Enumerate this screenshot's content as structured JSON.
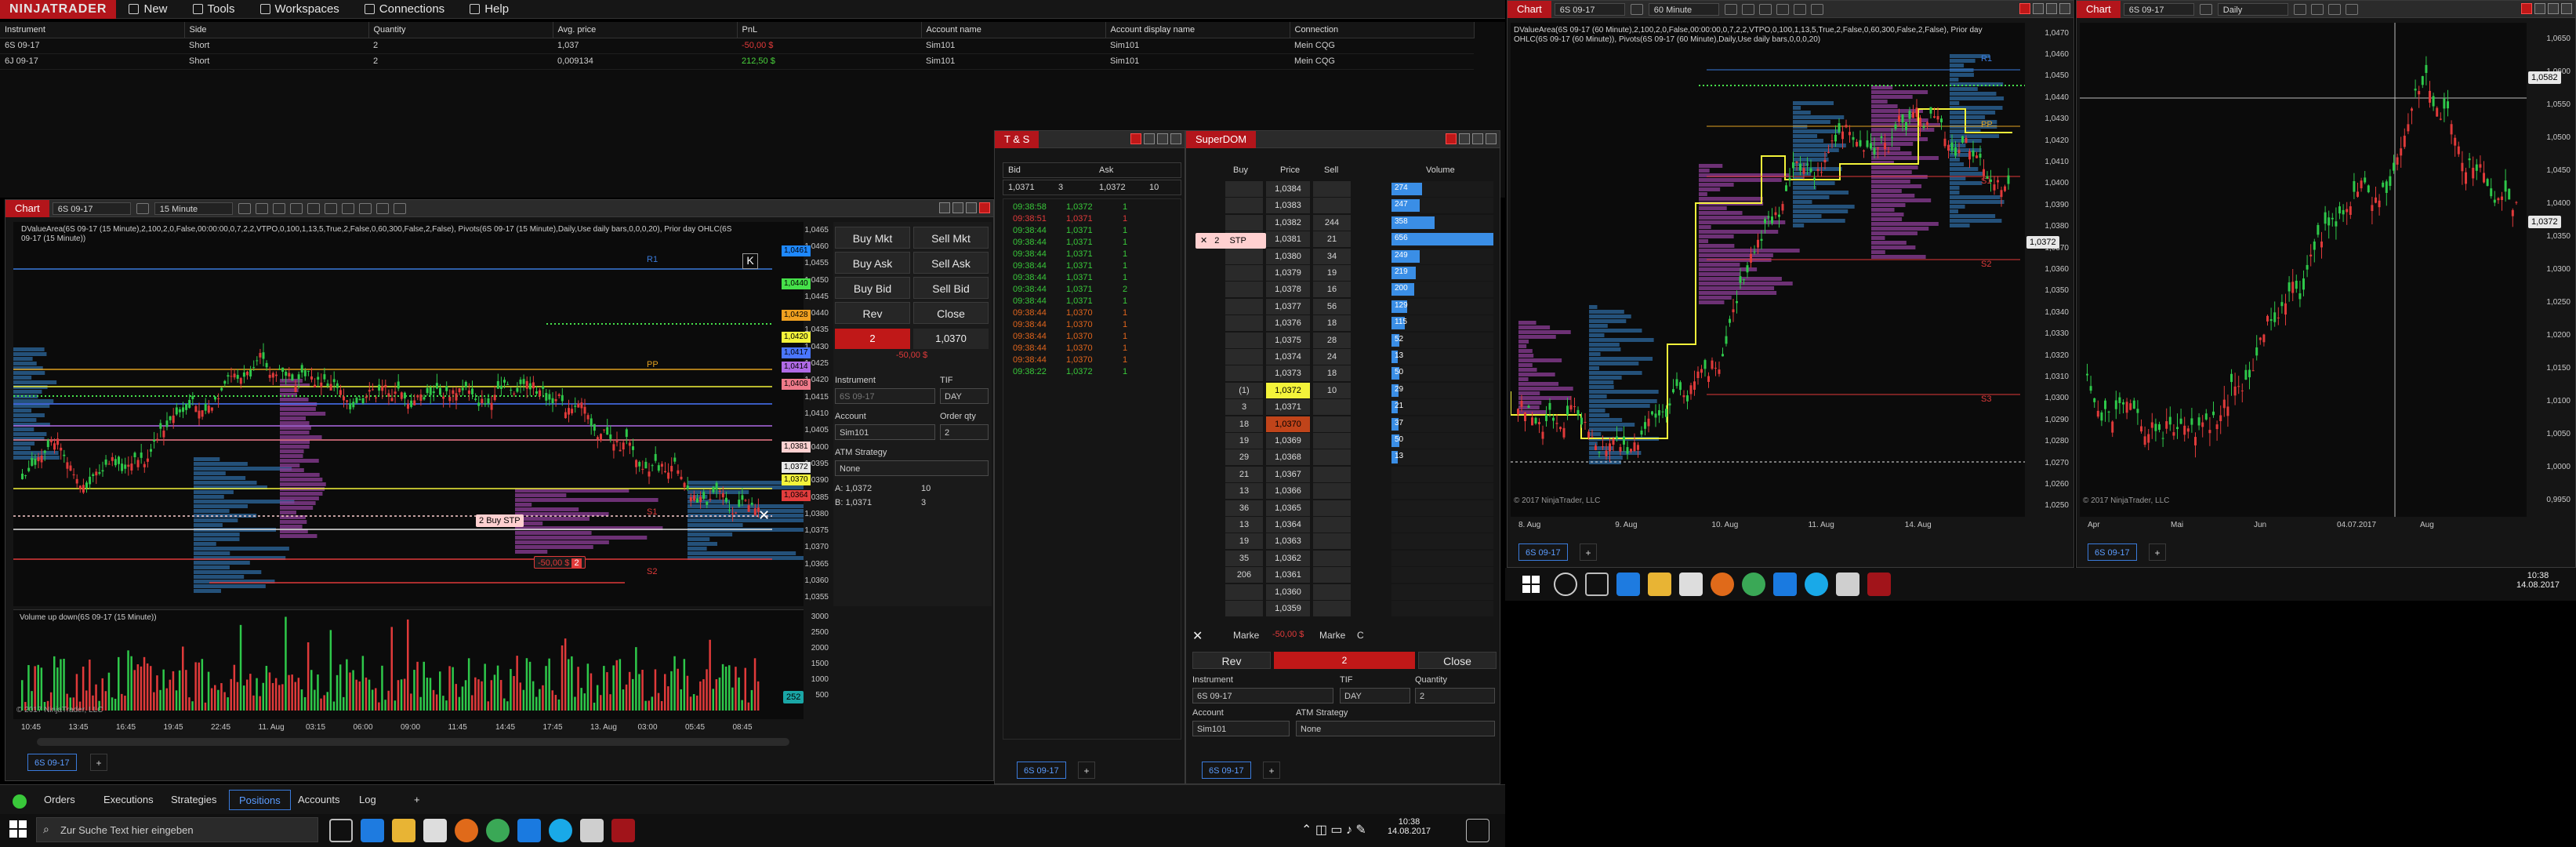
{
  "app": {
    "brand": "NINJATRADER",
    "menu": [
      {
        "label": "New",
        "icon": "new-icon"
      },
      {
        "label": "Tools",
        "icon": "tools-icon"
      },
      {
        "label": "Workspaces",
        "icon": "workspaces-icon"
      },
      {
        "label": "Connections",
        "icon": "connections-icon"
      },
      {
        "label": "Help",
        "icon": "help-icon"
      }
    ]
  },
  "positions": {
    "columns": [
      "Instrument",
      "Side",
      "Quantity",
      "Avg. price",
      "PnL",
      "Account name",
      "Account display name",
      "Connection"
    ],
    "rows": [
      [
        "6S 09-17",
        "Short",
        "2",
        "1,037",
        "-50,00 $",
        "Sim101",
        "Sim101",
        "Mein CQG"
      ],
      [
        "6J 09-17",
        "Short",
        "2",
        "0,009134",
        "212,50 $",
        "Sim101",
        "Sim101",
        "Mein CQG"
      ]
    ],
    "tabs": [
      "Orders",
      "Executions",
      "Strategies",
      "Positions",
      "Accounts",
      "Log"
    ],
    "active_tab": "Positions"
  },
  "chart1": {
    "title": "Chart",
    "instrument": "6S 09-17",
    "interval": "15 Minute",
    "indicator_text": "DValueArea(6S 09-17 (15 Minute),2,100,2,0,False,00:00:00,0,7,2,2,VTPO,0,100,1,13,5,True,2,False,0,60,300,False,2,False), Pivots(6S 09-17 (15 Minute),Daily,Use daily bars,0,0,0,20), Prior day OHLC(6S 09-17 (15 Minute))",
    "volume_label": "Volume up down(6S 09-17 (15 Minute))",
    "copyright": "© 2017 NinjaTrader, LLC",
    "y_ticks": [
      "1,0465",
      "1,0460",
      "1,0455",
      "1,0450",
      "1,0445",
      "1,0440",
      "1,0435",
      "1,0430",
      "1,0425",
      "1,0420",
      "1,0415",
      "1,0410",
      "1,0405",
      "1,0400",
      "1,0395",
      "1,0390",
      "1,0385",
      "1,0380",
      "1,0375",
      "1,0370",
      "1,0365",
      "1,0360",
      "1,0355"
    ],
    "price_labels": [
      {
        "text": "1,0461",
        "color": "#1e88ff"
      },
      {
        "text": "1,0440",
        "color": "#46e04a"
      },
      {
        "text": "1,0428",
        "color": "#f0a020"
      },
      {
        "text": "1,0420",
        "color": "#f3f33a"
      },
      {
        "text": "1,0417",
        "color": "#4a76ff"
      },
      {
        "text": "1,0414",
        "color": "#b06ae6"
      },
      {
        "text": "1,0408",
        "color": "#ef7a8a"
      },
      {
        "text": "1,0381",
        "color": "#ffd0d0"
      },
      {
        "text": "1,0372",
        "color": "#e8e8e8"
      },
      {
        "text": "1,0370",
        "color": "#f3f33a"
      },
      {
        "text": "1,0364",
        "color": "#e23d3d"
      }
    ],
    "level_tags": [
      "R1",
      "PP",
      "S1",
      "S2"
    ],
    "order_tag": {
      "qty": "2",
      "type": "Buy STP"
    },
    "pnl_tag": {
      "pnl": "-50,00 $",
      "qty": "2"
    },
    "x_ticks": [
      "10:45",
      "13:45",
      "16:45",
      "19:45",
      "22:45",
      "11. Aug",
      "03:15",
      "06:00",
      "09:00",
      "11:45",
      "14:45",
      "17:45",
      "13. Aug",
      "03:00",
      "05:45",
      "08:45"
    ],
    "vol_ticks": [
      "3000",
      "2500",
      "2000",
      "1500",
      "1000",
      "500"
    ],
    "vol_last": "252",
    "tab": "6S 09-17"
  },
  "order_panel": {
    "buy_mkt": "Buy Mkt",
    "sell_mkt": "Sell Mkt",
    "buy_ask": "Buy Ask",
    "sell_ask": "Sell Ask",
    "buy_bid": "Buy Bid",
    "sell_bid": "Sell Bid",
    "rev": "Rev",
    "close": "Close",
    "position_qty": "2",
    "position_price": "1,0370",
    "position_pnl": "-50,00 $",
    "instrument_label": "Instrument",
    "instrument_value": "6S 09-17",
    "tif_label": "TIF",
    "tif_value": "DAY",
    "account_label": "Account",
    "account_value": "Sim101",
    "qty_label": "Order qty",
    "qty_value": "2",
    "atm_label": "ATM Strategy",
    "atm_value": "None",
    "ask_line": "A: 1,0372",
    "ask_size": "10",
    "bid_line": "B: 1,0371",
    "bid_size": "3"
  },
  "ts": {
    "title": "T & S",
    "bid_label": "Bid",
    "ask_label": "Ask",
    "bid": "1,0371",
    "bid_size": "3",
    "ask": "1,0372",
    "ask_size": "10",
    "rows": [
      {
        "time": "09:38:58",
        "price": "1,0372",
        "size": "1",
        "color": "#39c83a"
      },
      {
        "time": "09:38:51",
        "price": "1,0371",
        "size": "1",
        "color": "#e03a3a"
      },
      {
        "time": "09:38:44",
        "price": "1,0371",
        "size": "1",
        "color": "#39c83a"
      },
      {
        "time": "09:38:44",
        "price": "1,0371",
        "size": "1",
        "color": "#39c83a"
      },
      {
        "time": "09:38:44",
        "price": "1,0371",
        "size": "1",
        "color": "#39c83a"
      },
      {
        "time": "09:38:44",
        "price": "1,0371",
        "size": "1",
        "color": "#39c83a"
      },
      {
        "time": "09:38:44",
        "price": "1,0371",
        "size": "1",
        "color": "#39c83a"
      },
      {
        "time": "09:38:44",
        "price": "1,0371",
        "size": "2",
        "color": "#39c83a"
      },
      {
        "time": "09:38:44",
        "price": "1,0371",
        "size": "1",
        "color": "#39c83a"
      },
      {
        "time": "09:38:44",
        "price": "1,0370",
        "size": "1",
        "color": "#e0651d"
      },
      {
        "time": "09:38:44",
        "price": "1,0370",
        "size": "1",
        "color": "#e0651d"
      },
      {
        "time": "09:38:44",
        "price": "1,0370",
        "size": "1",
        "color": "#e0651d"
      },
      {
        "time": "09:38:44",
        "price": "1,0370",
        "size": "1",
        "color": "#e0651d"
      },
      {
        "time": "09:38:44",
        "price": "1,0370",
        "size": "1",
        "color": "#e0651d"
      },
      {
        "time": "09:38:22",
        "price": "1,0372",
        "size": "1",
        "color": "#39c83a"
      }
    ],
    "tab": "6S 09-17"
  },
  "superdom": {
    "title": "SuperDOM",
    "col_buy": "Buy",
    "col_price": "Price",
    "col_sell": "Sell",
    "col_volume": "Volume",
    "rows": [
      {
        "buy": "",
        "price": "1,0384",
        "sell": "",
        "vol": "274",
        "volpct": 0.3
      },
      {
        "buy": "",
        "price": "1,0383",
        "sell": "",
        "vol": "247",
        "volpct": 0.28
      },
      {
        "buy": "",
        "price": "1,0382",
        "sell": "244",
        "vol": "358",
        "volpct": 0.42
      },
      {
        "buy": "",
        "price": "1,0381",
        "sell": "21",
        "vol": "656",
        "volpct": 1.0
      },
      {
        "buy": "",
        "price": "1,0380",
        "sell": "34",
        "vol": "249",
        "volpct": 0.28
      },
      {
        "buy": "",
        "price": "1,0379",
        "sell": "19",
        "vol": "219",
        "volpct": 0.24
      },
      {
        "buy": "",
        "price": "1,0378",
        "sell": "16",
        "vol": "200",
        "volpct": 0.22
      },
      {
        "buy": "",
        "price": "1,0377",
        "sell": "56",
        "vol": "129",
        "volpct": 0.15
      },
      {
        "buy": "",
        "price": "1,0376",
        "sell": "18",
        "vol": "115",
        "volpct": 0.13
      },
      {
        "buy": "",
        "price": "1,0375",
        "sell": "28",
        "vol": "52",
        "volpct": 0.08
      },
      {
        "buy": "",
        "price": "1,0374",
        "sell": "24",
        "vol": "13",
        "volpct": 0.06
      },
      {
        "buy": "",
        "price": "1,0373",
        "sell": "18",
        "vol": "50",
        "volpct": 0.08
      },
      {
        "buy": "(1)",
        "price": "1,0372",
        "sell": "10",
        "vol": "29",
        "volpct": 0.07
      },
      {
        "buy": "3",
        "price": "1,0371",
        "sell": "",
        "vol": "21",
        "volpct": 0.06
      },
      {
        "buy": "18",
        "price": "1,0370",
        "sell": "",
        "vol": "37",
        "volpct": 0.07
      },
      {
        "buy": "19",
        "price": "1,0369",
        "sell": "",
        "vol": "50",
        "volpct": 0.08
      },
      {
        "buy": "29",
        "price": "1,0368",
        "sell": "",
        "vol": "13",
        "volpct": 0.06
      },
      {
        "buy": "21",
        "price": "1,0367",
        "sell": "",
        "vol": "",
        "volpct": 0
      },
      {
        "buy": "13",
        "price": "1,0366",
        "sell": "",
        "vol": "",
        "volpct": 0
      },
      {
        "buy": "36",
        "price": "1,0365",
        "sell": "",
        "vol": "",
        "volpct": 0
      },
      {
        "buy": "13",
        "price": "1,0364",
        "sell": "",
        "vol": "",
        "volpct": 0
      },
      {
        "buy": "19",
        "price": "1,0363",
        "sell": "",
        "vol": "",
        "volpct": 0
      },
      {
        "buy": "35",
        "price": "1,0362",
        "sell": "",
        "vol": "",
        "volpct": 0
      },
      {
        "buy": "206",
        "price": "1,0361",
        "sell": "",
        "vol": "",
        "volpct": 0
      },
      {
        "buy": "",
        "price": "1,0360",
        "sell": "",
        "vol": "",
        "volpct": 0
      },
      {
        "buy": "",
        "price": "1,0359",
        "sell": "",
        "vol": "",
        "volpct": 0
      }
    ],
    "stop_order": {
      "qty": "2",
      "type": "STP"
    },
    "market_buy": "Marke",
    "pnl": "-50,00 $",
    "market_sell": "Marke",
    "c": "C",
    "rev": "Rev",
    "qty_box": "2",
    "close": "Close",
    "instrument_label": "Instrument",
    "instrument_value": "6S 09-17",
    "tif_label": "TIF",
    "tif_value": "DAY",
    "quantity_label": "Quantity",
    "quantity_value": "2",
    "account_label": "Account",
    "account_value": "Sim101",
    "atm_label": "ATM Strategy",
    "atm_value": "None",
    "tab": "6S 09-17"
  },
  "chart2": {
    "title": "Chart",
    "instrument": "6S 09-17",
    "interval": "60 Minute",
    "indicator_text": "DValueArea(6S 09-17 (60 Minute),2,100,2,0,False,00:00:00,0,7,2,2,VTPO,0,100,1,13,5,True,2,False,0,60,300,False,2,False), Prior day OHLC(6S 09-17 (60 Minute)), Pivots(6S 09-17 (60 Minute),Daily,Use daily bars,0,0,0,20)",
    "y_ticks": [
      "1,0470",
      "1,0460",
      "1,0450",
      "1,0440",
      "1,0430",
      "1,0420",
      "1,0410",
      "1,0400",
      "1,0390",
      "1,0380",
      "1,0370",
      "1,0360",
      "1,0350",
      "1,0340",
      "1,0330",
      "1,0320",
      "1,0310",
      "1,0300",
      "1,0290",
      "1,0280",
      "1,0270",
      "1,0260",
      "1,0250"
    ],
    "last": "1,0372",
    "x_ticks": [
      "8. Aug",
      "9. Aug",
      "10. Aug",
      "11. Aug",
      "14. Aug"
    ],
    "level_tags": [
      "R1",
      "PP",
      "S1",
      "S2",
      "S3"
    ],
    "copyright": "© 2017 NinjaTrader, LLC",
    "tab": "6S 09-17"
  },
  "chart3": {
    "title": "Chart",
    "instrument": "6S 09-17",
    "interval": "Daily",
    "y_ticks": [
      "1,0650",
      "1,0600",
      "1,0550",
      "1,0500",
      "1,0450",
      "1,0400",
      "1,0350",
      "1,0300",
      "1,0250",
      "1,0200",
      "1,0150",
      "1,0100",
      "1,0050",
      "1,0000",
      "0,9950"
    ],
    "cursor_price": "1,0582",
    "last": "1,0372",
    "x_ticks": [
      "Apr",
      "Mai",
      "Jun",
      "04.07.2017",
      "Aug"
    ],
    "copyright": "© 2017 NinjaTrader, LLC",
    "tab": "6S 09-17"
  },
  "taskbar": {
    "search_placeholder": "Zur Suche Text hier eingeben",
    "time": "10:38",
    "date": "14.08.2017"
  },
  "taskbar2": {
    "time": "10:38",
    "date": "14.08.2017"
  }
}
